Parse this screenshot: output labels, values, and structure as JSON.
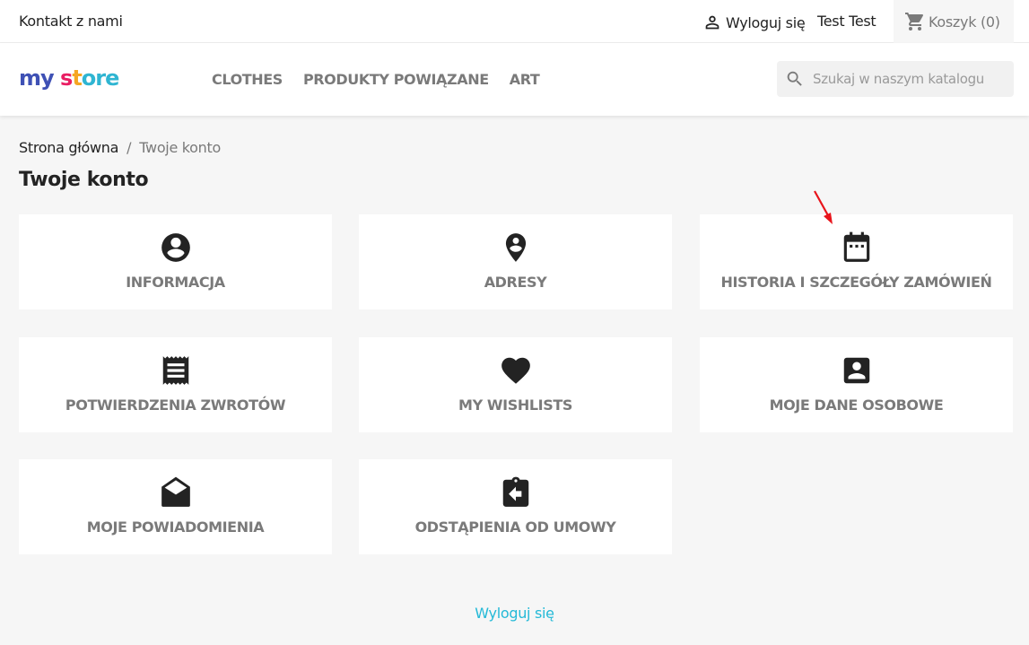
{
  "topbar": {
    "contact": "Kontakt z nami",
    "signout": "Wyloguj się",
    "username": "Test Test",
    "cart": "Koszyk (0)"
  },
  "header": {
    "logo": {
      "part1": "my",
      "part2": "s",
      "part3": "t",
      "part4": "ore"
    },
    "nav": [
      "CLOTHES",
      "PRODUKTY POWIĄZANE",
      "ART"
    ],
    "search_placeholder": "Szukaj w naszym katalogu"
  },
  "breadcrumb": {
    "home": "Strona główna",
    "separator": "/",
    "current": "Twoje konto"
  },
  "page_title": "Twoje konto",
  "tiles": [
    {
      "label": "INFORMACJA",
      "icon": "account-circle-icon"
    },
    {
      "label": "ADRESY",
      "icon": "location-pin-icon"
    },
    {
      "label": "HISTORIA I SZCZEGÓŁY ZAMÓWIEŃ",
      "icon": "calendar-icon"
    },
    {
      "label": "POTWIERDZENIA ZWROTÓW",
      "icon": "receipt-icon"
    },
    {
      "label": "MY WISHLISTS",
      "icon": "heart-icon"
    },
    {
      "label": "MOJE DANE OSOBOWE",
      "icon": "contact-card-icon"
    },
    {
      "label": "MOJE POWIADOMIENIA",
      "icon": "open-envelope-icon"
    },
    {
      "label": "ODSTĄPIENIA OD UMOWY",
      "icon": "clipboard-return-icon"
    }
  ],
  "footer_logout": "Wyloguj się",
  "colors": {
    "accent": "#24b9d7",
    "text_dark": "#232323",
    "text_muted": "#7a7a7a",
    "background": "#f6f6f6",
    "annotation_arrow": "#e8141b"
  }
}
